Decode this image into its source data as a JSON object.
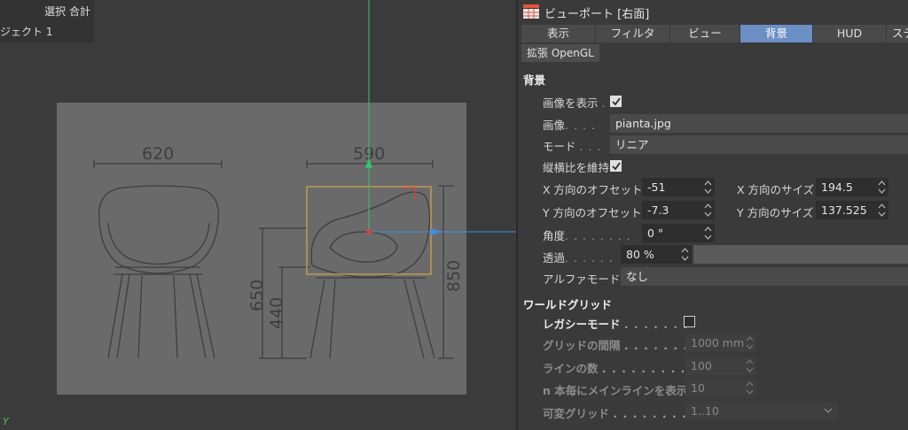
{
  "viewport": {
    "info_line1": "選択 合計",
    "info_line2": "ジェクト 1",
    "dims": {
      "front_width": "620",
      "side_width": "590",
      "height_total": "850",
      "height_650": "650",
      "height_440": "440"
    },
    "y_axis": "Y",
    "colors": {
      "bg": "#3b3b3b",
      "image_bg": "#6a6a6a",
      "y_axis": "#34c46a",
      "x_axis": "#3a8ee6",
      "selection": "#d8a64c"
    }
  },
  "panel": {
    "title": "ビューポート [右面]",
    "icon": "viewport-grid-icon",
    "tabs": [
      "表示",
      "フィルタ",
      "ビュー",
      "背景",
      "HUD",
      "ステ"
    ],
    "active_tab": "背景",
    "subtab": "拡張 OpenGL",
    "background": {
      "heading": "背景",
      "show_image_label": "画像を表示",
      "show_image_dots": ".",
      "show_image_checked": true,
      "image_label": "画像",
      "image_dots": ". . . .",
      "image_value": "pianta.jpg",
      "mode_label": "モード",
      "mode_dots": ". . .",
      "mode_value": "リニア",
      "keep_aspect_label": "縦横比を維持",
      "keep_aspect_checked": true,
      "x_offset_label": "X 方向のオフセット",
      "x_offset_value": "-51",
      "y_offset_label": "Y 方向のオフセット",
      "y_offset_value": "-7.3",
      "x_size_label": "X 方向のサイズ",
      "x_size_value": "194.5",
      "y_size_label": "Y 方向のサイズ",
      "y_size_value": "137.525",
      "angle_label": "角度",
      "angle_dots": ". . . . . . . .",
      "angle_value": "0 °",
      "transparency_label": "透過",
      "transparency_dots": ". . . . . .",
      "transparency_value": "80 %",
      "transparency_fraction": 0.8,
      "alpha_mode_label": "アルファモード",
      "alpha_mode_value": "なし"
    },
    "world_grid": {
      "heading": "ワールドグリッド",
      "legacy_label": "レガシーモード",
      "legacy_dots": ". . . . . . .",
      "legacy_checked": false,
      "grid_spacing_label": "グリッドの間隔",
      "grid_spacing_dots": ". . . . . . .",
      "grid_spacing_value": "1000 mm",
      "line_count_label": "ラインの数",
      "line_count_dots": ". . . . . . . . . .",
      "line_count_value": "100",
      "major_every_label": "n 本毎にメインラインを表示",
      "major_every_value": "10",
      "dynamic_grid_label": "可変グリッド",
      "dynamic_grid_dots": ". . . . . . . .",
      "dynamic_grid_value": "1..10"
    }
  }
}
